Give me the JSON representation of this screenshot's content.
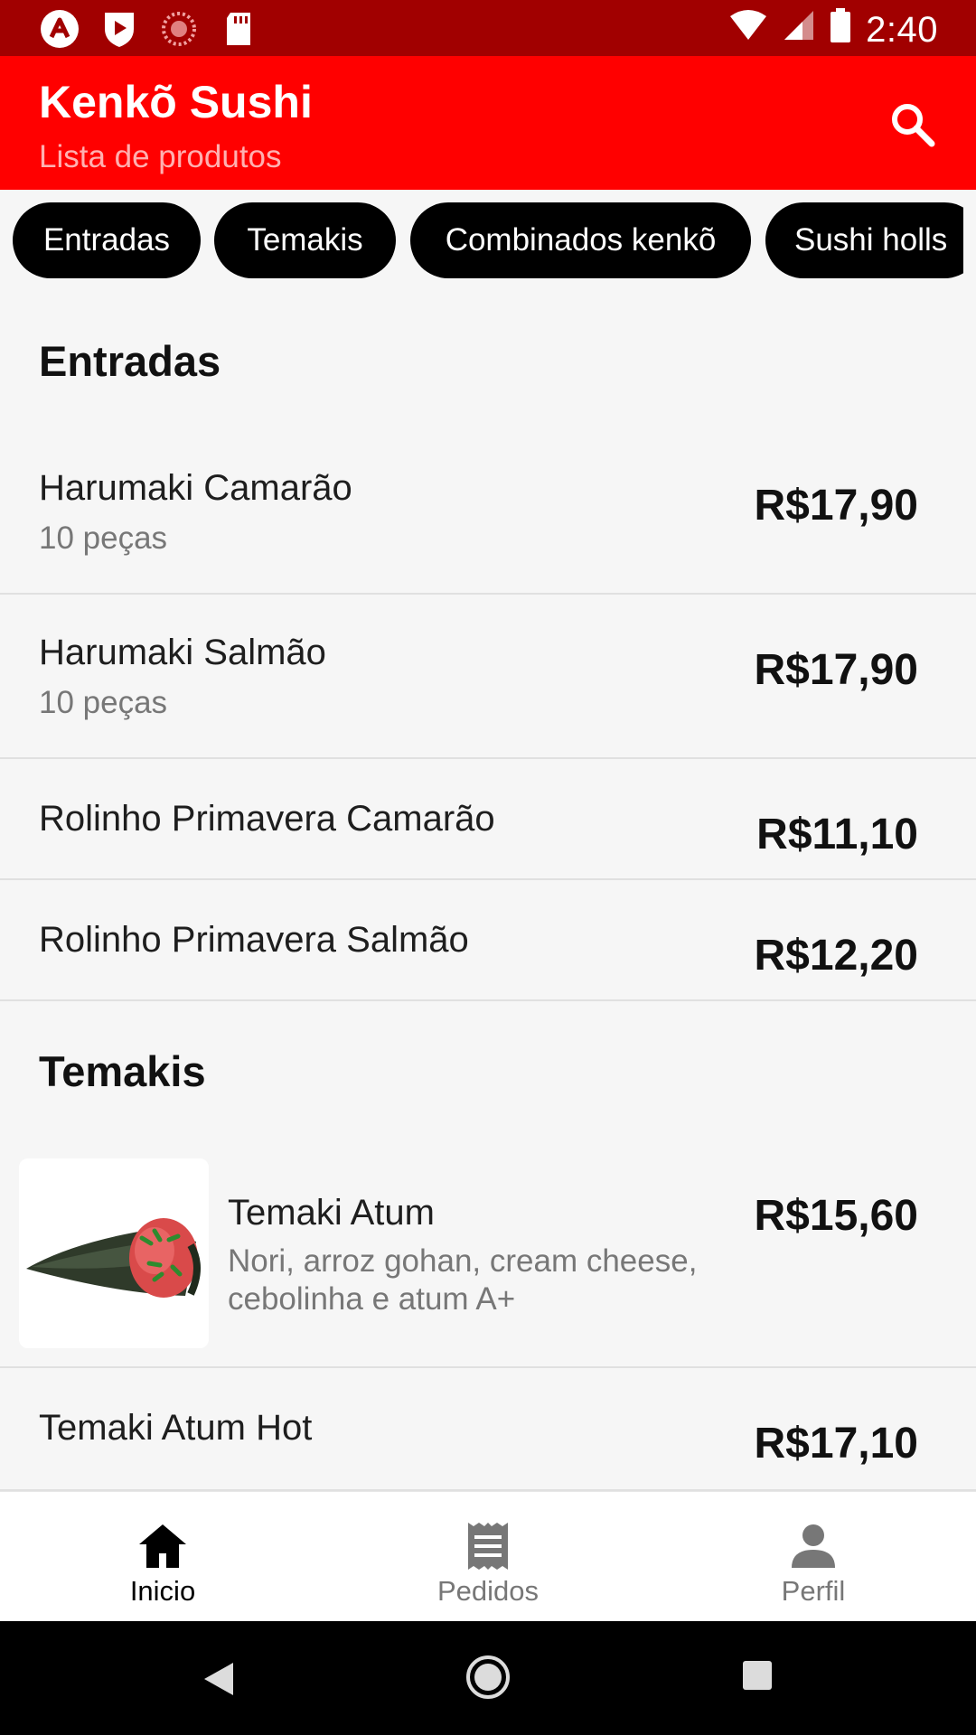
{
  "status_bar": {
    "time": "2:40",
    "left_icons": [
      "app-a-icon",
      "shield-play-icon",
      "circle-dots-icon",
      "sd-card-icon"
    ],
    "right_icons": [
      "wifi-icon",
      "signal-icon",
      "battery-icon"
    ]
  },
  "app_bar": {
    "title": "Kenkõ Sushi",
    "subtitle": "Lista de produtos",
    "search_icon": "search-icon"
  },
  "categories": [
    "Entradas",
    "Temakis",
    "Combinados kenkõ",
    "Sushi holls"
  ],
  "sections": [
    {
      "title": "Entradas",
      "items": [
        {
          "name": "Harumaki Camarão",
          "description": "10 peças",
          "price": "R$17,90"
        },
        {
          "name": "Harumaki Salmão",
          "description": "10 peças",
          "price": "R$17,90"
        },
        {
          "name": "Rolinho Primavera Camarão",
          "price": "R$11,10"
        },
        {
          "name": "Rolinho Primavera Salmão",
          "price": "R$12,20"
        }
      ]
    },
    {
      "title": "Temakis",
      "items": [
        {
          "name": "Temaki Atum",
          "description_line1": "Nori, arroz gohan, cream cheese,",
          "description_line2": "cebolinha e atum A+",
          "price": "R$15,60",
          "image": "temaki-image"
        },
        {
          "name": "Temaki Atum Hot",
          "price": "R$17,10"
        }
      ]
    }
  ],
  "bottom_nav": [
    {
      "label": "Inicio",
      "icon": "home-icon",
      "active": true
    },
    {
      "label": "Pedidos",
      "icon": "receipt-icon",
      "active": false
    },
    {
      "label": "Perfil",
      "icon": "person-icon",
      "active": false
    }
  ],
  "colors": {
    "status_bar": "#a10000",
    "app_bar": "#ff0000",
    "chip_bg": "#000000",
    "active_nav": "#000000",
    "inactive_nav": "#777777"
  }
}
